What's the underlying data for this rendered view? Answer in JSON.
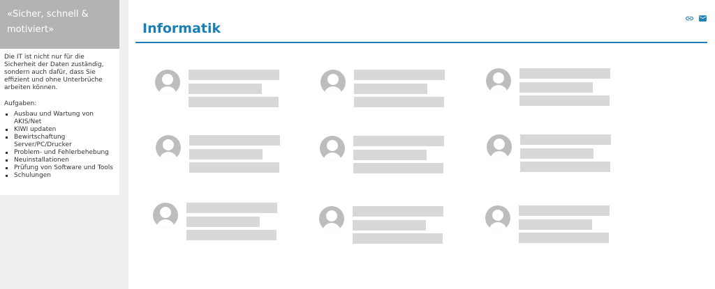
{
  "sidebar": {
    "quote_line1": "«Sicher, schnell &",
    "quote_line2": "motiviert»",
    "intro": "Die IT ist nicht nur für die Sicherheit der Daten zuständig, sondern auch dafür, dass Sie effizient und ohne Unterbrüche arbeiten können.",
    "tasks_heading": "Aufgaben:",
    "tasks": [
      "Ausbau und Wartung von AKIS/Net",
      "KIWI updaten",
      "Bewirtschaftung Server/PC/Drucker",
      "Problem- und Fehlerbehebung",
      "Neuinstallationen",
      "Prüfung von Software und Tools",
      "Schulungen"
    ]
  },
  "main": {
    "title": "Informatik",
    "icons": [
      "link-icon",
      "mail-icon"
    ],
    "accent_color": "#1a7fb5",
    "placeholder_color": "#d8d8d8"
  }
}
